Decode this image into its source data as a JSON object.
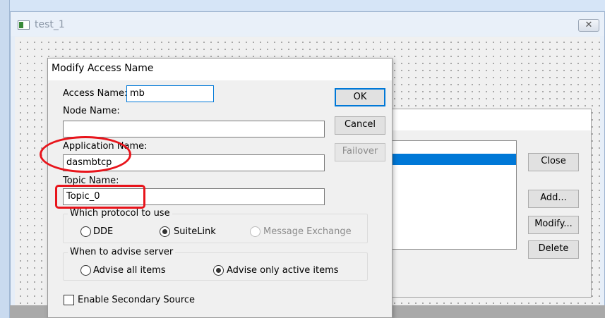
{
  "window": {
    "title": "test_1",
    "close_symbol": "✕"
  },
  "access_names_dialog": {
    "close_label": "Close",
    "add_label": "Add...",
    "modify_label": "Modify...",
    "delete_label": "Delete"
  },
  "modify_dialog": {
    "title": "Modify Access Name",
    "access_name": {
      "label": "Access Name:",
      "value": "mb"
    },
    "node_name": {
      "label": "Node Name:",
      "value": ""
    },
    "application_name": {
      "label": "Application Name:",
      "value": "dasmbtcp"
    },
    "topic_name": {
      "label": "Topic Name:",
      "value": "Topic_0"
    },
    "ok_label": "OK",
    "cancel_label": "Cancel",
    "failover_label": "Failover",
    "protocol_group": {
      "title": "Which protocol to use",
      "options": [
        "DDE",
        "SuiteLink",
        "Message Exchange"
      ],
      "selected": "SuiteLink"
    },
    "advise_group": {
      "title": "When to advise server",
      "options": [
        "Advise all items",
        "Advise only active items"
      ],
      "selected": "Advise only active items"
    },
    "secondary_source": {
      "label": "Enable Secondary Source",
      "checked": false
    }
  },
  "colors": {
    "annotation": "#e8141b",
    "selection": "#0078d7"
  }
}
